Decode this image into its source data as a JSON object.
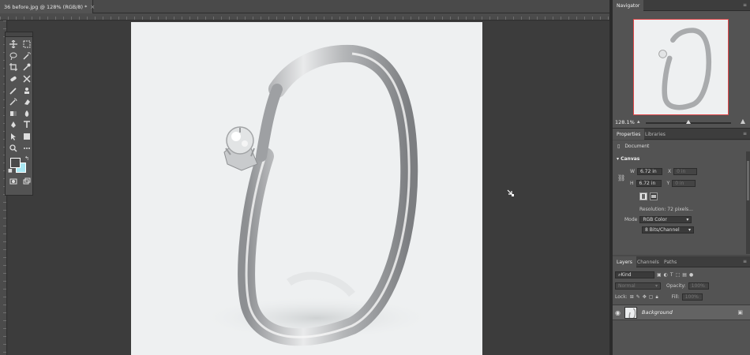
{
  "document": {
    "tab_title": "36 before.jpg @ 128% (RGB/8) *",
    "close_symbol": "×"
  },
  "tools": {
    "items": [
      "move-tool-icon",
      "marquee-tool-icon",
      "lasso-tool-icon",
      "magic-wand-icon",
      "crop-tool-icon",
      "eyedropper-icon",
      "healing-brush-icon",
      "patch-tool-icon",
      "brush-tool-icon",
      "clone-stamp-icon",
      "history-brush-icon",
      "eraser-icon",
      "gradient-tool-icon",
      "blur-tool-icon",
      "pen-tool-icon",
      "type-tool-icon",
      "path-selection-icon",
      "shape-tool-icon",
      "hand-tool-icon",
      "more-tools-icon",
      "quick-mask-icon",
      "screen-mode-icon"
    ],
    "colors": {
      "foreground": "#4a4a4a",
      "background": "#a8e7f2"
    }
  },
  "navigator": {
    "tab_label": "Navigator",
    "zoom_value": "128.1%",
    "zoom_level": 0.5,
    "frame_color": "#e0484a"
  },
  "properties": {
    "tabs": [
      "Properties",
      "Libraries"
    ],
    "document_label": "Document",
    "section": "Canvas",
    "width_label": "W",
    "width_value": "6.72 in",
    "height_label": "H",
    "height_value": "6.72 in",
    "x_label": "X",
    "x_value": "0 in",
    "y_label": "Y",
    "y_value": "0 in",
    "resolution": "Resolution: 72 pixels...",
    "mode_label": "Mode",
    "mode_value": "RGB Color",
    "depth_value": "8 Bits/Channel"
  },
  "layers": {
    "tabs": [
      "Layers",
      "Channels",
      "Paths"
    ],
    "filter_placeholder": "Kind",
    "blend_mode": "Normal",
    "opacity_label": "Opacity:",
    "opacity_value": "100%",
    "lock_label": "Lock:",
    "fill_label": "Fill:",
    "fill_value": "100%",
    "layer_name": "Background"
  }
}
